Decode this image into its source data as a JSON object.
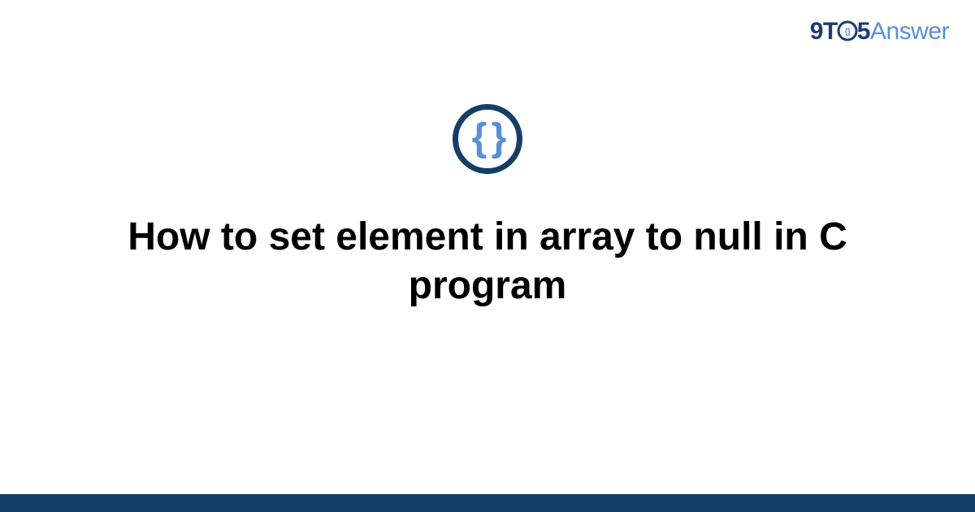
{
  "logo": {
    "part1": "9T",
    "part2": "5",
    "part3": "Answer"
  },
  "icon": {
    "name": "braces-icon",
    "glyph": "{ }"
  },
  "title": "How to set element in array to null in C program",
  "colors": {
    "dark_blue": "#153e66",
    "logo_dark": "#1b3b7a",
    "light_blue": "#5a8fd6"
  }
}
